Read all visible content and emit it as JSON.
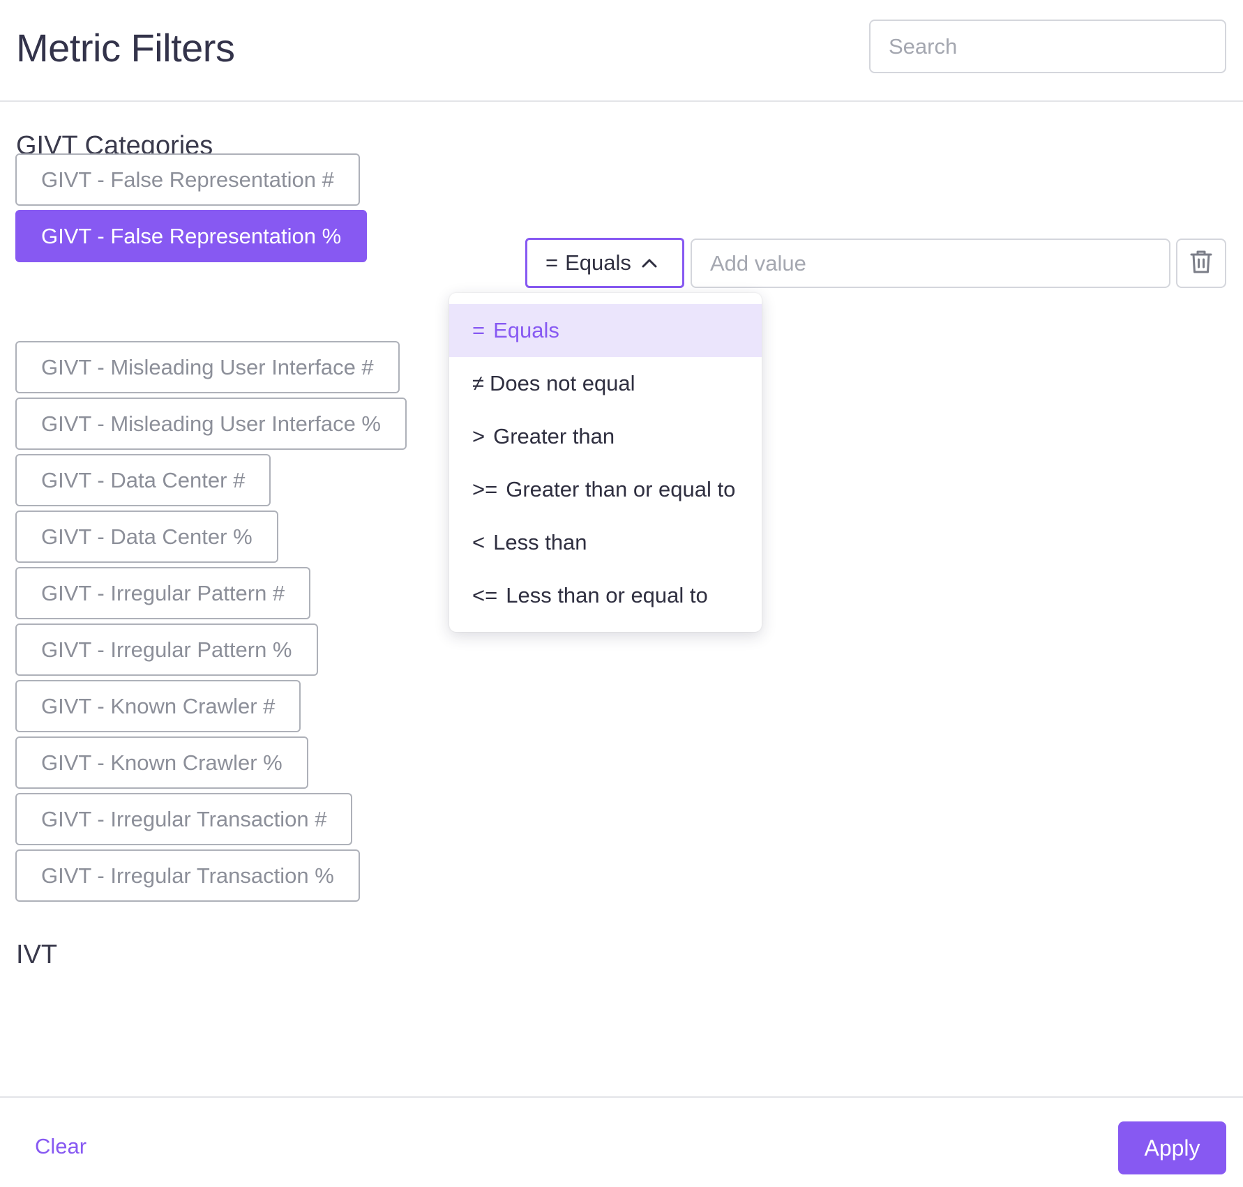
{
  "header": {
    "title": "Metric Filters",
    "search_placeholder": "Search"
  },
  "sections": {
    "givt_title": "GIVT Categories",
    "ivt_title": "IVT"
  },
  "givt_chips": [
    {
      "label": "GIVT - False Representation #",
      "active": false
    },
    {
      "label": "GIVT - False Representation %",
      "active": true
    },
    {
      "label": "GIVT - Misleading User Interface #",
      "active": false
    },
    {
      "label": "GIVT - Misleading User Interface %",
      "active": false
    },
    {
      "label": "GIVT - Data Center #",
      "active": false
    },
    {
      "label": "GIVT - Data Center %",
      "active": false
    },
    {
      "label": "GIVT - Irregular Pattern #",
      "active": false
    },
    {
      "label": "GIVT - Irregular Pattern %",
      "active": false
    },
    {
      "label": "GIVT - Known Crawler #",
      "active": false
    },
    {
      "label": "GIVT - Known Crawler %",
      "active": false
    },
    {
      "label": "GIVT - Irregular Transaction #",
      "active": false
    },
    {
      "label": "GIVT - Irregular Transaction %",
      "active": false
    }
  ],
  "filter_row": {
    "operator_symbol": "=",
    "operator_label": "Equals",
    "value_placeholder": "Add value",
    "delete_icon": "trash-icon",
    "caret_icon": "chevron-up-icon"
  },
  "operator_options": [
    {
      "symbol": "=",
      "label": "Equals",
      "selected": true
    },
    {
      "symbol": "≠",
      "label": "Does not equal",
      "selected": false
    },
    {
      "symbol": ">",
      "label": "Greater than",
      "selected": false
    },
    {
      "symbol": ">=",
      "label": "Greater than or equal to",
      "selected": false
    },
    {
      "symbol": "<",
      "label": "Less than",
      "selected": false
    },
    {
      "symbol": "<=",
      "label": "Less than or equal to",
      "selected": false
    }
  ],
  "footer": {
    "clear_label": "Clear",
    "apply_label": "Apply"
  },
  "colors": {
    "accent": "#8759f2",
    "selected_bg": "#ebe5fc",
    "border": "#aeb1b9",
    "muted_text": "#8c8f99"
  }
}
